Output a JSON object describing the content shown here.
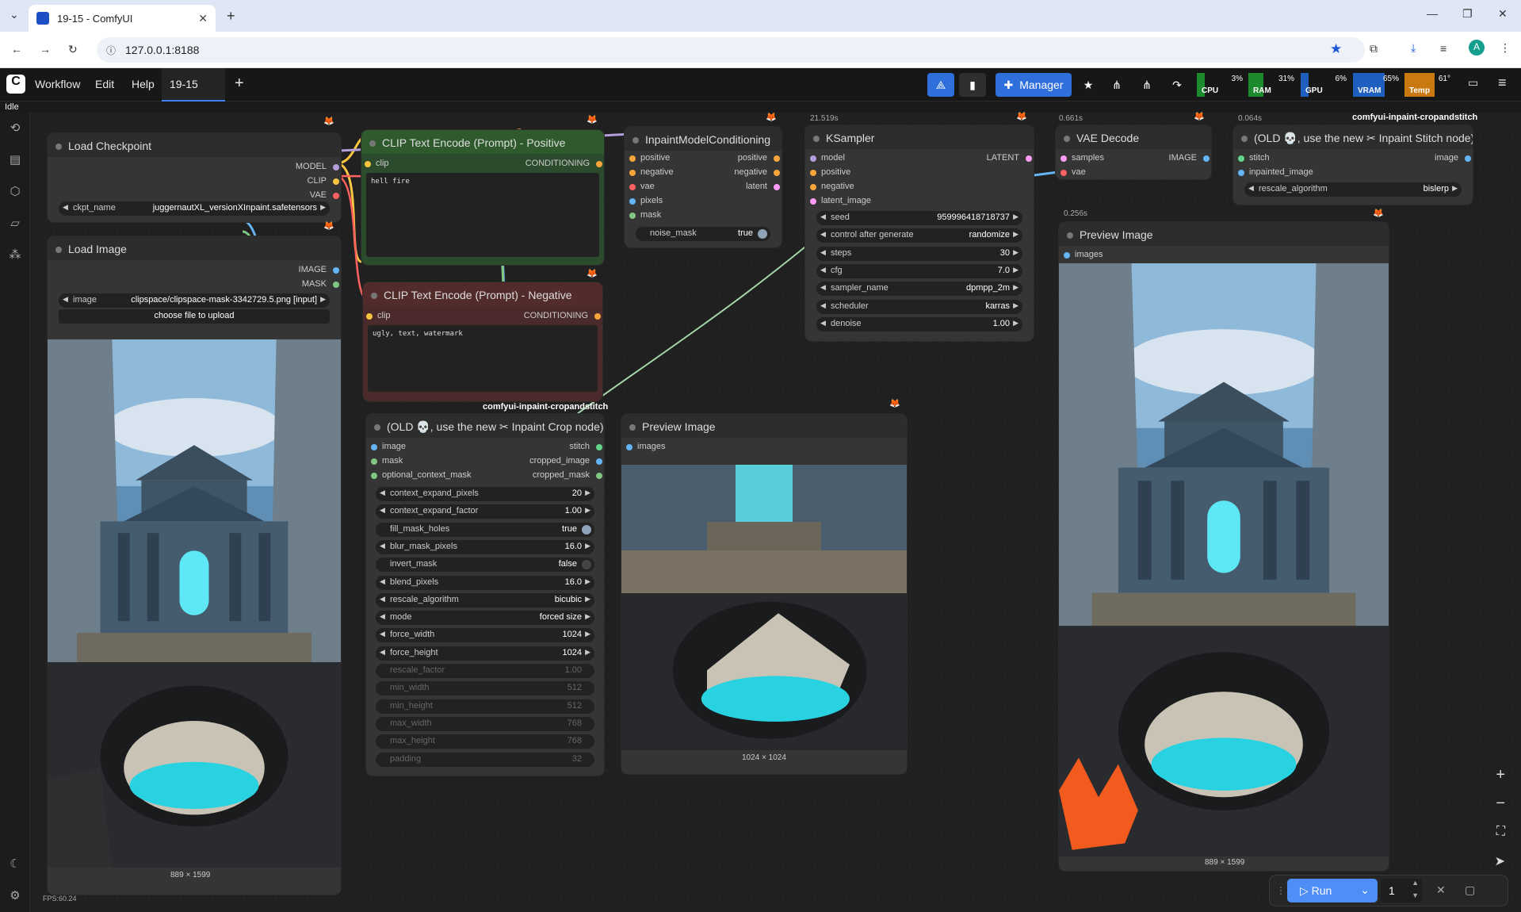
{
  "browser": {
    "tab_title": "19-15 - ComfyUI",
    "url": "127.0.0.1:8188"
  },
  "app": {
    "menus": [
      "Workflow",
      "Edit",
      "Help"
    ],
    "workflow_tab": "19-15",
    "manager_label": "Manager",
    "status": "Idle",
    "fps": "FPS:60.24",
    "monitors": [
      {
        "label": "CPU",
        "pct": "3%",
        "color": "#1e8a2e",
        "level": 0.03
      },
      {
        "label": "RAM",
        "pct": "31%",
        "color": "#1e8a2e",
        "level": 0.31
      },
      {
        "label": "GPU",
        "pct": "6%",
        "color": "#1f5fbf",
        "level": 0.06
      },
      {
        "label": "VRAM",
        "pct": "65%",
        "color": "#1f5fbf",
        "level": 0.65
      },
      {
        "label": "Temp",
        "pct": "61°",
        "color": "#c8790f",
        "level": 0.61
      }
    ],
    "run_label": "Run",
    "batch_count": "1"
  },
  "nodes": {
    "load_checkpoint": {
      "title": "Load Checkpoint",
      "outputs": [
        "MODEL",
        "CLIP",
        "VAE"
      ],
      "ckpt_label": "ckpt_name",
      "ckpt_value": "juggernautXL_versionXInpaint.safetensors"
    },
    "load_image": {
      "title": "Load Image",
      "outputs": [
        "IMAGE",
        "MASK"
      ],
      "image_label": "image",
      "image_value": "clipspace/clipspace-mask-3342729.5.png [input]",
      "upload_label": "choose file to upload",
      "dims": "889 × 1599"
    },
    "clip_pos": {
      "title": "CLIP Text Encode (Prompt) - Positive",
      "input": "clip",
      "output": "CONDITIONING",
      "text": "hell fire"
    },
    "clip_neg": {
      "title": "CLIP Text Encode (Prompt) - Negative",
      "input": "clip",
      "output": "CONDITIONING",
      "text": "ugly, text, watermark",
      "group": "comfyui-inpaint-cropandstitch"
    },
    "inpaint_cond": {
      "title": "InpaintModelConditioning",
      "inputs": [
        "positive",
        "negative",
        "vae",
        "pixels",
        "mask"
      ],
      "outputs": [
        "positive",
        "negative",
        "latent"
      ],
      "noise_label": "noise_mask",
      "noise_value": "true"
    },
    "ksampler": {
      "title": "KSampler",
      "time": "21.519s",
      "inputs": [
        "model",
        "positive",
        "negative",
        "latent_image"
      ],
      "output": "LATENT",
      "widgets": [
        {
          "label": "seed",
          "value": "959996418718737"
        },
        {
          "label": "control after generate",
          "value": "randomize"
        },
        {
          "label": "steps",
          "value": "30"
        },
        {
          "label": "cfg",
          "value": "7.0"
        },
        {
          "label": "sampler_name",
          "value": "dpmpp_2m"
        },
        {
          "label": "scheduler",
          "value": "karras"
        },
        {
          "label": "denoise",
          "value": "1.00"
        }
      ]
    },
    "vae_decode": {
      "title": "VAE Decode",
      "time": "0.661s",
      "inputs": [
        "samples",
        "vae"
      ],
      "output": "IMAGE"
    },
    "stitch": {
      "title_prefix": "(OLD",
      "title_suffix": ", use the new",
      "title_tail": "Inpaint Stitch node)",
      "time": "0.064s",
      "group": "comfyui-inpaint-cropandstitch",
      "inputs": [
        "stitch",
        "inpainted_image"
      ],
      "output": "image",
      "rescale_label": "rescale_algorithm",
      "rescale_value": "bislerp"
    },
    "preview_right": {
      "title": "Preview Image",
      "time": "0.256s",
      "input": "images",
      "dims": "889 × 1599"
    },
    "crop": {
      "title_prefix": "(OLD",
      "title_suffix": ", use the new",
      "title_tail": "Inpaint Crop node)",
      "inputs": [
        "image",
        "mask",
        "optional_context_mask"
      ],
      "outputs": [
        "stitch",
        "cropped_image",
        "cropped_mask"
      ],
      "widgets": [
        {
          "label": "context_expand_pixels",
          "value": "20",
          "type": "num"
        },
        {
          "label": "context_expand_factor",
          "value": "1.00",
          "type": "num"
        },
        {
          "label": "fill_mask_holes",
          "value": "true",
          "type": "toggle"
        },
        {
          "label": "blur_mask_pixels",
          "value": "16.0",
          "type": "num"
        },
        {
          "label": "invert_mask",
          "value": "false",
          "type": "toggle"
        },
        {
          "label": "blend_pixels",
          "value": "16.0",
          "type": "num"
        },
        {
          "label": "rescale_algorithm",
          "value": "bicubic",
          "type": "num"
        },
        {
          "label": "mode",
          "value": "forced size",
          "type": "num"
        },
        {
          "label": "force_width",
          "value": "1024",
          "type": "num"
        },
        {
          "label": "force_height",
          "value": "1024",
          "type": "num"
        },
        {
          "label": "rescale_factor",
          "value": "1.00",
          "type": "dis"
        },
        {
          "label": "min_width",
          "value": "512",
          "type": "dis"
        },
        {
          "label": "min_height",
          "value": "512",
          "type": "dis"
        },
        {
          "label": "max_width",
          "value": "768",
          "type": "dis"
        },
        {
          "label": "max_height",
          "value": "768",
          "type": "dis"
        },
        {
          "label": "padding",
          "value": "32",
          "type": "dis"
        }
      ]
    },
    "preview_mid": {
      "title": "Preview Image",
      "input": "images",
      "dims": "1024 × 1024"
    }
  }
}
